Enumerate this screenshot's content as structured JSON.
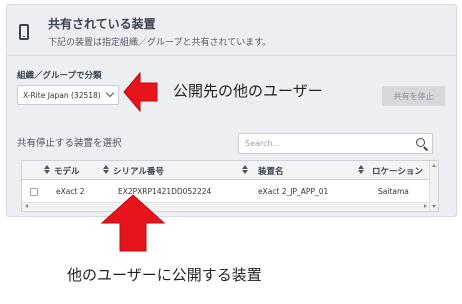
{
  "header": {
    "title": "共有されている装置",
    "subtitle": "下記の装置は指定組織／グループと共有されています。",
    "icon": "phone-icon"
  },
  "group": {
    "label": "組織／グループで分類",
    "selected": "X-Rite Japan (32518)"
  },
  "stop_button_label": "共有を停止",
  "section_title": "共有停止する装置を選択",
  "search": {
    "placeholder": "Search..."
  },
  "table": {
    "columns": [
      "モデル",
      "シリアル番号",
      "装置名",
      "ロケーション"
    ],
    "rows": [
      {
        "model": "eXact 2",
        "serial": "EX2PXRP1421DD052224",
        "name": "eXact 2_JP_APP_01",
        "location": "Saitama"
      }
    ]
  },
  "annotations": {
    "arrow_color": "#e8141b",
    "left_arrow_text": "公開先の他のユーザー",
    "up_arrow_text": "他のユーザーに公開する装置"
  }
}
